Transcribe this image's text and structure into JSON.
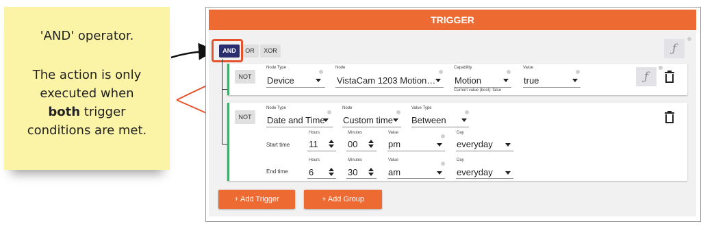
{
  "note": {
    "line1": "'AND' operator.",
    "line2": "The action is only",
    "line3": "executed when",
    "line4_bold": "both",
    "line4_rest": " trigger",
    "line5": "conditions are met."
  },
  "panel": {
    "title": "TRIGGER",
    "function_symbol": "ƒ"
  },
  "operators": {
    "and": "AND",
    "or": "OR",
    "xor": "XOR"
  },
  "condition1": {
    "not_label": "NOT",
    "node_type_label": "Node Type",
    "node_type": "Device",
    "node_label": "Node",
    "node": "VistaCam 1203 Motion…",
    "capability_label": "Capability",
    "capability": "Motion",
    "current_value": "Current value (bool): false",
    "value_label": "Value",
    "value": "true"
  },
  "condition2": {
    "not_label": "NOT",
    "node_type_label": "Node Type",
    "node_type": "Date and Time",
    "node_label": "Node",
    "node": "Custom time",
    "value_type_label": "Value Type",
    "value_type": "Between",
    "start": {
      "row_label": "Start time",
      "hours_label": "Hours",
      "hours": "11",
      "minutes_label": "Minutes",
      "minutes": "00",
      "value_label": "Value",
      "value": "pm",
      "day_label": "Day",
      "day": "everyday"
    },
    "end": {
      "row_label": "End time",
      "hours_label": "Hours",
      "hours": "6",
      "minutes_label": "Minutes",
      "minutes": "30",
      "value_label": "Value",
      "value": "am",
      "day_label": "Day",
      "day": "everyday"
    }
  },
  "buttons": {
    "add_trigger": "+  Add Trigger",
    "add_group": "+  Add Group"
  },
  "colors": {
    "accent": "#ee6a33",
    "and_active": "#2b2e6e",
    "connector": "#3fae6a",
    "highlight_box": "#e5532d"
  }
}
